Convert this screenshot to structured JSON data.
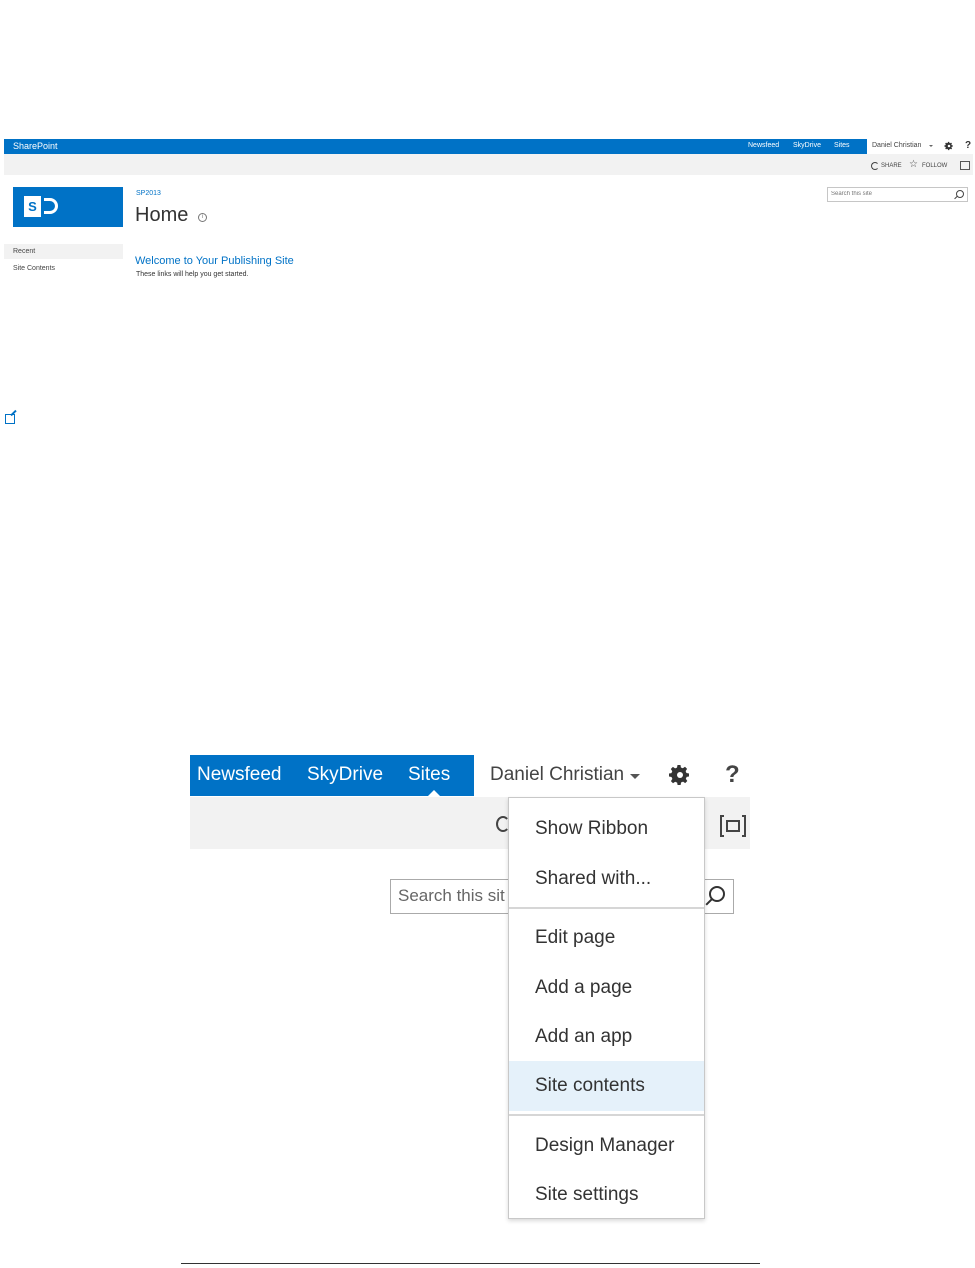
{
  "suite_bar": {
    "brand": "SharePoint",
    "links": [
      "Newsfeed",
      "SkyDrive",
      "Sites"
    ],
    "user": "Daniel Christian",
    "help": "?"
  },
  "ribbon": {
    "share": "SHARE",
    "follow": "FOLLOW"
  },
  "site": {
    "breadcrumb": "SP2013",
    "title": "Home",
    "info": "i"
  },
  "search": {
    "placeholder": "Search this site"
  },
  "quick_launch": {
    "recent": "Recent",
    "site_contents": "Site Contents"
  },
  "welcome": {
    "title": "Welcome to Your Publishing Site",
    "subtitle": "These links will help you get started."
  },
  "zoom": {
    "links": [
      "Newsfeed",
      "SkyDrive",
      "Sites"
    ],
    "user": "Daniel Christian",
    "help": "?",
    "search_text": "Search this sit",
    "menu": {
      "items": [
        "Show Ribbon",
        "Shared with...",
        "Edit page",
        "Add a page",
        "Add an app",
        "Site contents",
        "Design Manager",
        "Site settings"
      ],
      "highlighted": "Site contents"
    }
  },
  "colors": {
    "brand": "#0072c6",
    "ribbon": "#f2f2f2",
    "highlight": "#e5f1fa"
  }
}
